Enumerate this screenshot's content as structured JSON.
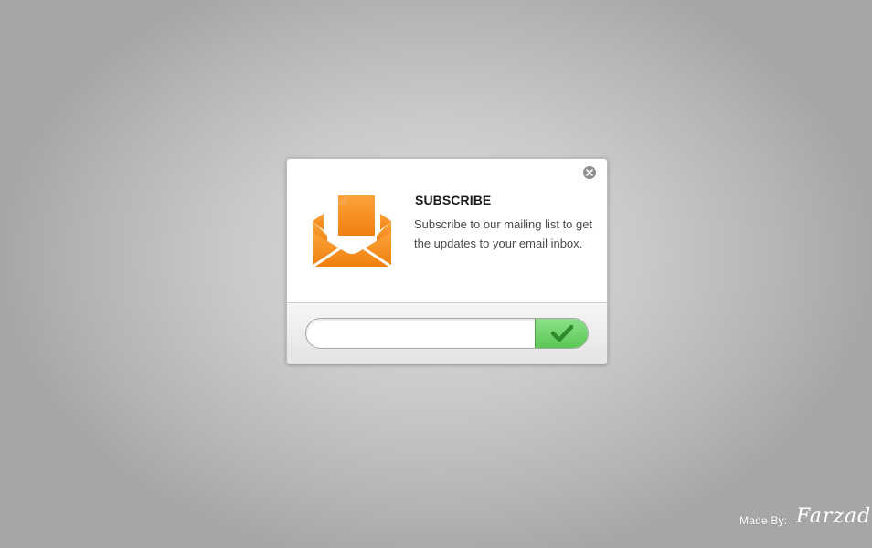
{
  "dialog": {
    "title": "SUBSCRIBE",
    "description": "Subscribe to our mailing list to get the updates to your email inbox.",
    "close_icon": "close-icon",
    "illustration_icon": "envelope-letter-icon",
    "email_input": {
      "value": "",
      "placeholder": ""
    },
    "submit_icon": "checkmark-icon"
  },
  "footer": {
    "credit_label": "Made By:",
    "signature": "Farzad Ba"
  },
  "colors": {
    "accent_orange": "#f7931e",
    "submit_green": "#6dd168",
    "checkmark_green": "#2f8a2b",
    "background_gray": "#c8c8c8"
  }
}
